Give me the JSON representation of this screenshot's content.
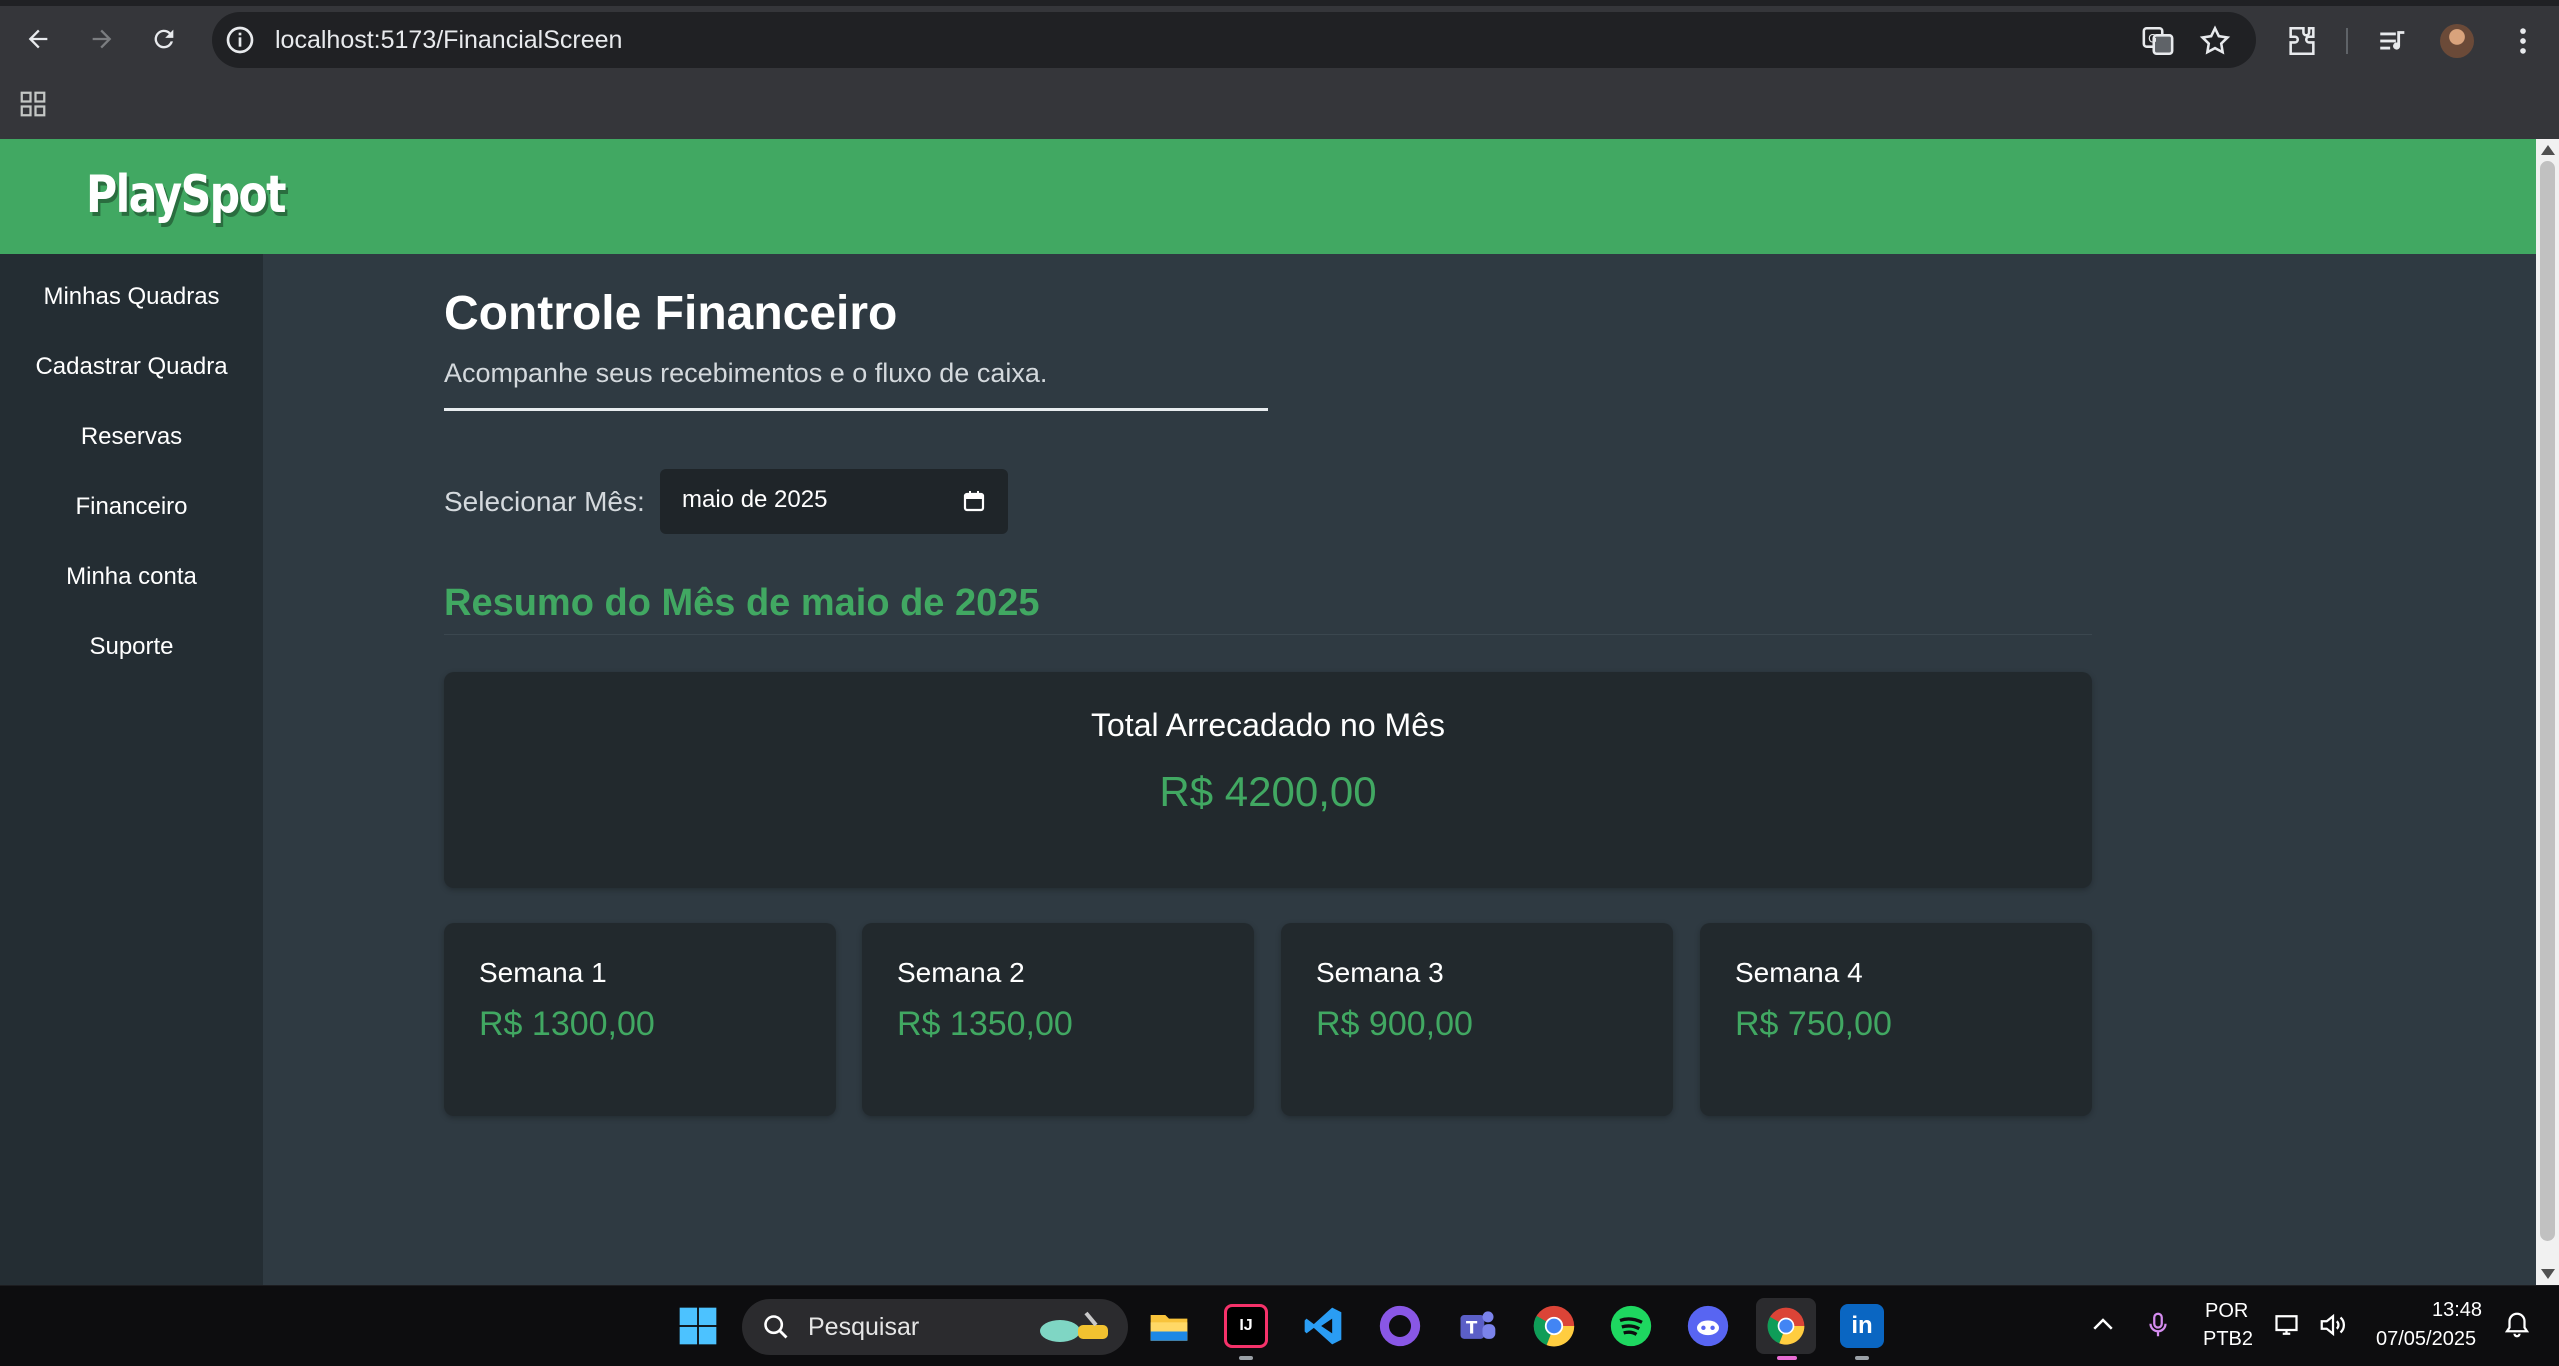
{
  "browser": {
    "url": "localhost:5173/FinancialScreen",
    "icons": [
      "back-icon",
      "forward-icon",
      "reload-icon",
      "site-info-icon",
      "translate-icon",
      "bookmark-star-icon",
      "extensions-icon",
      "media-control-icon",
      "profile-avatar",
      "chrome-menu-icon",
      "apps-grid-icon"
    ]
  },
  "app": {
    "logo": "PlaySpot",
    "colors": {
      "accent": "#41a862",
      "page_bg": "#2f3a42",
      "sidebar_bg": "#242d33",
      "card_bg": "#22292d"
    }
  },
  "sidebar": {
    "items": [
      {
        "label": "Minhas Quadras"
      },
      {
        "label": "Cadastrar Quadra"
      },
      {
        "label": "Reservas"
      },
      {
        "label": "Financeiro"
      },
      {
        "label": "Minha conta"
      },
      {
        "label": "Suporte"
      }
    ]
  },
  "main": {
    "title": "Controle Financeiro",
    "subtitle": "Acompanhe seus recebimentos e o fluxo de caixa.",
    "month_label": "Selecionar Mês:",
    "month_value": "maio de 2025",
    "summary_title": "Resumo do Mês de maio de 2025",
    "total_label": "Total Arrecadado no Mês",
    "total_value": "R$ 4200,00",
    "weeks": [
      {
        "label": "Semana 1",
        "value": "R$ 1300,00"
      },
      {
        "label": "Semana 2",
        "value": "R$ 1350,00"
      },
      {
        "label": "Semana 3",
        "value": "R$ 900,00"
      },
      {
        "label": "Semana 4",
        "value": "R$ 750,00"
      }
    ]
  },
  "taskbar": {
    "search_placeholder": "Pesquisar",
    "apps": [
      "windows-start-icon",
      "file-explorer-icon",
      "intellij-icon",
      "vscode-icon",
      "github-desktop-icon",
      "teams-icon",
      "chrome-icon",
      "spotify-icon",
      "discord-icon",
      "chrome-profile-icon",
      "linkedin-icon"
    ],
    "language_line1": "POR",
    "language_line2": "PTB2",
    "time": "13:48",
    "date": "07/05/2025"
  }
}
